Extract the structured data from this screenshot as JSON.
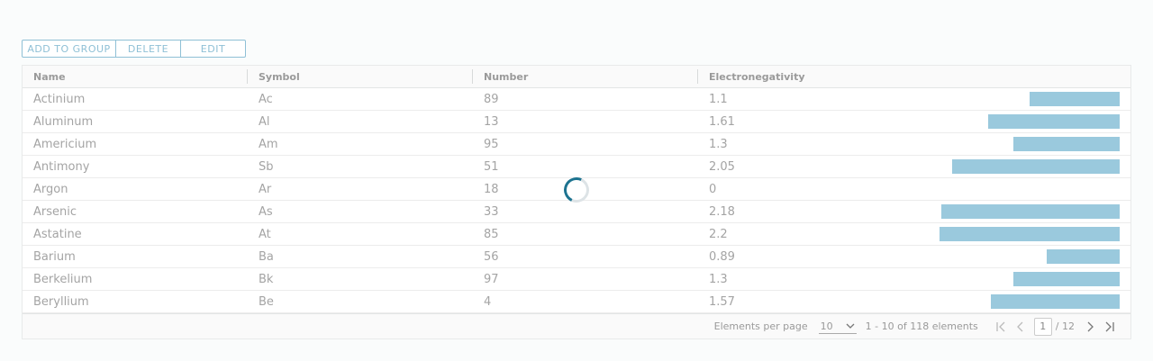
{
  "toolbar": {
    "add_to_group": "ADD TO GROUP",
    "delete": "DELETE",
    "edit": "EDIT"
  },
  "columns": [
    "Name",
    "Symbol",
    "Number",
    "Electronegativity"
  ],
  "rows": [
    {
      "name": "Actinium",
      "symbol": "Ac",
      "number": "89",
      "electronegativity": "1.1"
    },
    {
      "name": "Aluminum",
      "symbol": "Al",
      "number": "13",
      "electronegativity": "1.61"
    },
    {
      "name": "Americium",
      "symbol": "Am",
      "number": "95",
      "electronegativity": "1.3"
    },
    {
      "name": "Antimony",
      "symbol": "Sb",
      "number": "51",
      "electronegativity": "2.05"
    },
    {
      "name": "Argon",
      "symbol": "Ar",
      "number": "18",
      "electronegativity": "0"
    },
    {
      "name": "Arsenic",
      "symbol": "As",
      "number": "33",
      "electronegativity": "2.18"
    },
    {
      "name": "Astatine",
      "symbol": "At",
      "number": "85",
      "electronegativity": "2.2"
    },
    {
      "name": "Barium",
      "symbol": "Ba",
      "number": "56",
      "electronegativity": "0.89"
    },
    {
      "name": "Berkelium",
      "symbol": "Bk",
      "number": "97",
      "electronegativity": "1.3"
    },
    {
      "name": "Beryllium",
      "symbol": "Be",
      "number": "4",
      "electronegativity": "1.57"
    }
  ],
  "footer": {
    "per_page_label": "Elements per page",
    "per_page_value": "10",
    "range_text": "1 - 10 of 118 elements",
    "current_page": "1",
    "total_pages": "/ 12"
  },
  "icons": {
    "first": "first-page-icon",
    "prev": "previous-page-icon",
    "next": "next-page-icon",
    "last": "last-page-icon",
    "chevron": "chevron-down-icon",
    "spinner": "loading-spinner-icon"
  },
  "colors": {
    "accent": "#8fc0d6",
    "bar": "#9ac9dd",
    "spinner": "#1d7390"
  }
}
